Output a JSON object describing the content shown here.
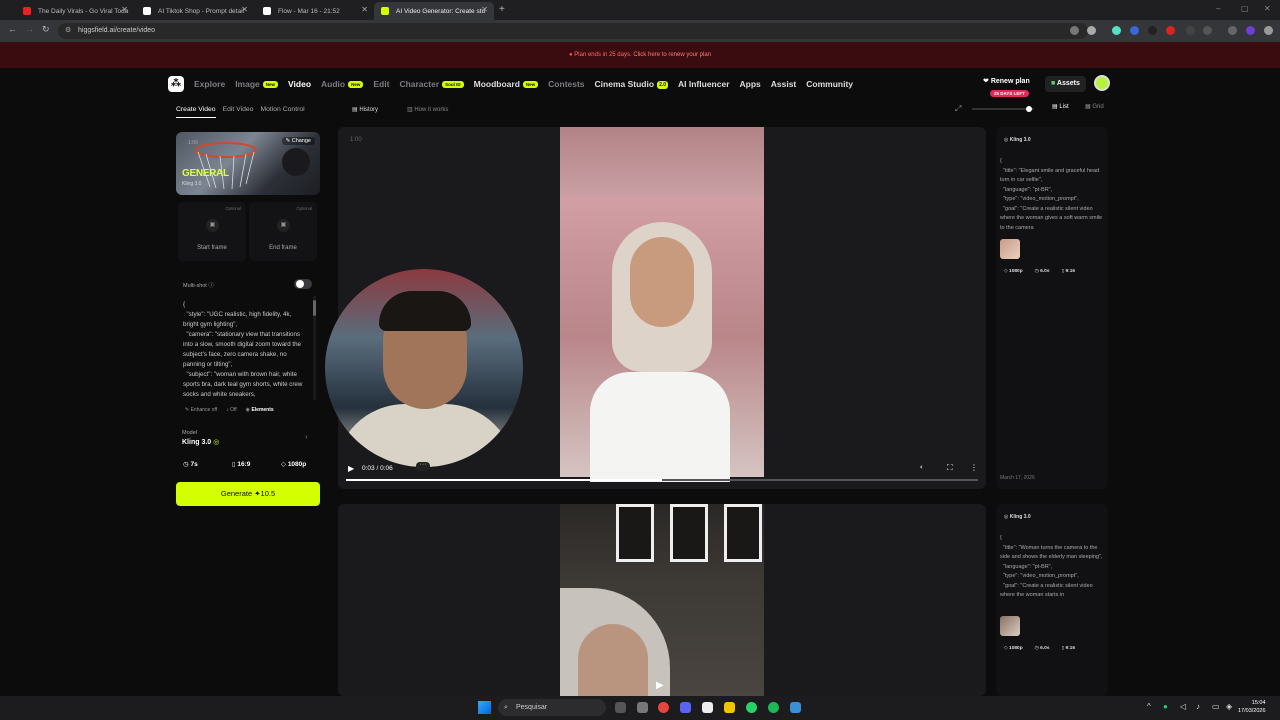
{
  "browser": {
    "tabs": [
      {
        "title": "The Daily Virals - Go Viral Toda",
        "color": "#e22"
      },
      {
        "title": "AI Tiktok Shop - Prompt detail",
        "color": "#fff"
      },
      {
        "title": "Flow - Mar 16 - 21:52",
        "color": "#fff"
      },
      {
        "title": "AI Video Generator: Create stu",
        "color": "#d4ff00"
      }
    ],
    "new_tab": "+",
    "url": "higgsfield.ai/create/video"
  },
  "promo": {
    "text": "Plan ends in 25 days.",
    "link": "Click here to renew your plan"
  },
  "nav": {
    "items": [
      {
        "label": "Explore",
        "badge": ""
      },
      {
        "label": "Image",
        "badge": "New"
      },
      {
        "label": "Video",
        "badge": ""
      },
      {
        "label": "Audio",
        "badge": "New"
      },
      {
        "label": "Edit",
        "badge": ""
      },
      {
        "label": "Character",
        "badge": "Soul ID"
      },
      {
        "label": "Moodboard",
        "badge": "New"
      },
      {
        "label": "Contests",
        "badge": ""
      },
      {
        "label": "Cinema Studio",
        "badge": "2.0"
      },
      {
        "label": "AI Influencer",
        "badge": ""
      },
      {
        "label": "Apps",
        "badge": ""
      },
      {
        "label": "Assist",
        "badge": ""
      },
      {
        "label": "Community",
        "badge": ""
      }
    ],
    "renew": "Renew plan",
    "days_left": "25 DAYS LEFT",
    "assets": "Assets"
  },
  "left": {
    "tabs": [
      "Create Video",
      "Edit Video",
      "Motion Control"
    ],
    "card_title": "GENERAL",
    "card_sub": "Kling 3.0",
    "card_change": "Change",
    "card_duration": "1:00",
    "start_frame": "Start frame",
    "end_frame": "End frame",
    "optional": "Optional",
    "multishot": "Multi-shot",
    "prompt": "{\n  \"style\": \"UGC realistic, high fidelity, 4k, bright gym lighting\",\n  \"camera\": \"stationary view that transitions into a slow, smooth digital zoom toward the subject's face, zero camera shake, no panning or tilting\",\n  \"subject\": \"woman with brown hair, white sports bra, dark teal gym shorts, white crew socks and white sneakers,",
    "enhance": "Enhance off",
    "off": "Off",
    "elements": "Elements",
    "model_label": "Model",
    "model_name": "Kling 3.0",
    "duration": "7s",
    "ratio": "16:9",
    "resolution": "1080p",
    "generate": "Generate",
    "credits": "10.5"
  },
  "history": {
    "history_btn": "History",
    "how_btn": "How it works",
    "list": "List",
    "grid": "Grid"
  },
  "video1": {
    "duration_label": "1:00",
    "time": "0:03 / 0:06",
    "progress": 0.5
  },
  "meta1": {
    "model": "Kling 3.0",
    "json": "{\n  \"title\": \"Elegant smile and graceful head turn in car selfie\",\n  \"language\": \"pt-BR\",\n  \"type\": \"video_motion_prompt\",\n  \"goal\": \"Create a realistic silent video where the woman gives a soft warm smile to the camera",
    "res": "1080p",
    "dur": "6.0s",
    "ratio": "9:16",
    "date": "March 17, 2026"
  },
  "meta2": {
    "model": "Kling 3.0",
    "json": "{\n  \"title\": \"Woman turns the camera to the side and shows the elderly man sleeping\",\n  \"language\": \"pt-BR\",\n  \"type\": \"video_motion_prompt\",\n  \"goal\": \"Create a realistic silent video where the woman starts in",
    "res": "1080p",
    "dur": "6.0s",
    "ratio": "9:16"
  },
  "taskbar": {
    "search": "Pesquisar",
    "time": "15:04",
    "date": "17/03/2026"
  }
}
